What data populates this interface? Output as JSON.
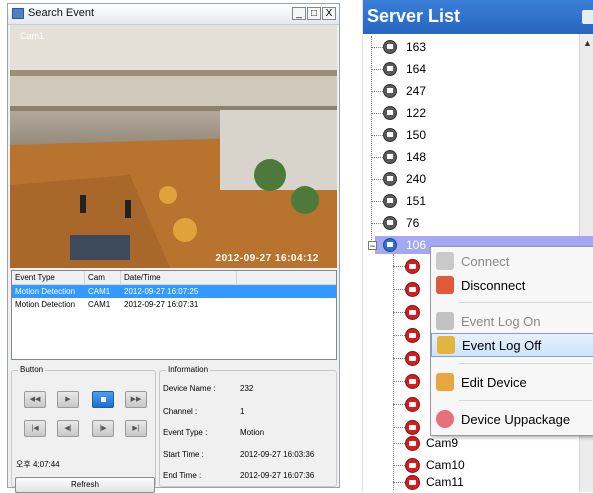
{
  "search_window": {
    "title": "Search Event",
    "controls": {
      "minimize": "_",
      "maximize": "□",
      "close": "X"
    },
    "video": {
      "camera_label": "Cam1",
      "timestamp": "2012-09-27 16:04:12"
    },
    "event_list": {
      "columns": [
        "Event Type",
        "Cam",
        "Date/Time"
      ],
      "rows": [
        {
          "type": "Motion Detection",
          "cam": "CAM1",
          "datetime": "2012-09-27 16:07:25",
          "selected": true
        },
        {
          "type": "Motion Detection",
          "cam": "CAM1",
          "datetime": "2012-09-27 16:07:31",
          "selected": false
        }
      ]
    },
    "button_group": {
      "title": "Button",
      "row1": [
        {
          "name": "rewind-button",
          "glyph": "◀◀"
        },
        {
          "name": "play-button",
          "glyph": "▶"
        },
        {
          "name": "stop-button",
          "glyph": "■",
          "active": true
        },
        {
          "name": "fast-forward-button",
          "glyph": "▶▶"
        }
      ],
      "row2": [
        {
          "name": "first-frame-button",
          "glyph": "|◀"
        },
        {
          "name": "step-back-button",
          "glyph": "◀|"
        },
        {
          "name": "step-forward-button",
          "glyph": "|▶"
        },
        {
          "name": "last-frame-button",
          "glyph": "▶|"
        }
      ],
      "time": "오후 4:07:44",
      "refresh_label": "Refresh"
    },
    "information": {
      "title": "Information",
      "rows": [
        {
          "label": "Device Name :",
          "value": "232"
        },
        {
          "label": "Channel :",
          "value": "1"
        },
        {
          "label": "Event Type :",
          "value": "Motion"
        },
        {
          "label": "Start Time :",
          "value": "2012-09-27 16:03:36"
        },
        {
          "label": "End Time :",
          "value": "2012-09-27 16:07:36"
        }
      ]
    }
  },
  "server_list": {
    "title": "Server List",
    "servers": [
      "163",
      "164",
      "247",
      "122",
      "150",
      "148",
      "240",
      "151",
      "76",
      "106"
    ],
    "cameras": [
      "Cam9",
      "Cam10",
      "Cam11"
    ],
    "context_menu": [
      {
        "label": "Connect",
        "disabled": true,
        "highlighted": false,
        "icon": "plug-connect-icon"
      },
      {
        "label": "Disconnect",
        "disabled": false,
        "highlighted": false,
        "icon": "plug-disconnect-icon"
      },
      {
        "label": "Event Log On",
        "disabled": true,
        "highlighted": false,
        "icon": "user-on-icon"
      },
      {
        "label": "Event Log Off",
        "disabled": false,
        "highlighted": true,
        "icon": "user-off-icon"
      },
      {
        "label": "Edit Device",
        "disabled": false,
        "highlighted": false,
        "icon": "edit-user-icon"
      },
      {
        "label": "Device Uppackage",
        "disabled": false,
        "highlighted": false,
        "icon": "package-icon"
      }
    ]
  }
}
